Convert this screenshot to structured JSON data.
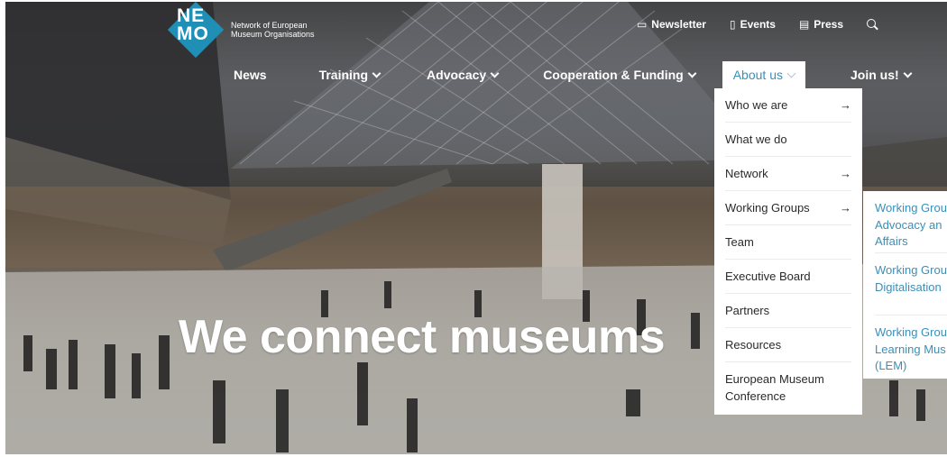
{
  "brand": {
    "logo_letters_top": "NE",
    "logo_letters_bottom": "MO",
    "name": "Network of European Museum Organisations",
    "logo_color": "#1f8fb5"
  },
  "utility_nav": [
    {
      "label": "Newsletter",
      "icon": "newsletter-icon"
    },
    {
      "label": "Events",
      "icon": "calendar-icon"
    },
    {
      "label": "Press",
      "icon": "press-icon"
    },
    {
      "label": "",
      "icon": "search-icon"
    }
  ],
  "main_nav": [
    {
      "label": "News",
      "has_dropdown": false
    },
    {
      "label": "Training",
      "has_dropdown": true
    },
    {
      "label": "Advocacy",
      "has_dropdown": true
    },
    {
      "label": "Cooperation & Funding",
      "has_dropdown": true
    },
    {
      "label": "About us",
      "has_dropdown": true,
      "active": true
    },
    {
      "label": "Join us!",
      "has_dropdown": true
    }
  ],
  "about_dropdown": [
    {
      "label": "Who we are",
      "has_submenu": true
    },
    {
      "label": "What we do",
      "has_submenu": false
    },
    {
      "label": "Network",
      "has_submenu": true
    },
    {
      "label": "Working Groups",
      "has_submenu": true
    },
    {
      "label": "Team",
      "has_submenu": false
    },
    {
      "label": "Executive Board",
      "has_submenu": false
    },
    {
      "label": "Partners",
      "has_submenu": false
    },
    {
      "label": "Resources",
      "has_submenu": false
    },
    {
      "label": "European Museum Conference",
      "has_submenu": false
    }
  ],
  "working_groups_submenu": [
    {
      "line1": "Working Grou",
      "line2": "Advocacy an",
      "line3": "Affairs"
    },
    {
      "line1": "Working Grou",
      "line2": "Digitalisation",
      "line3": ""
    },
    {
      "line1": "Working Grou",
      "line2": "Learning Mus",
      "line3": "(LEM)"
    }
  ],
  "hero": {
    "headline": "We connect museums"
  },
  "colors": {
    "accent": "#3a8fb7",
    "dropdown_bg": "#ffffff"
  }
}
